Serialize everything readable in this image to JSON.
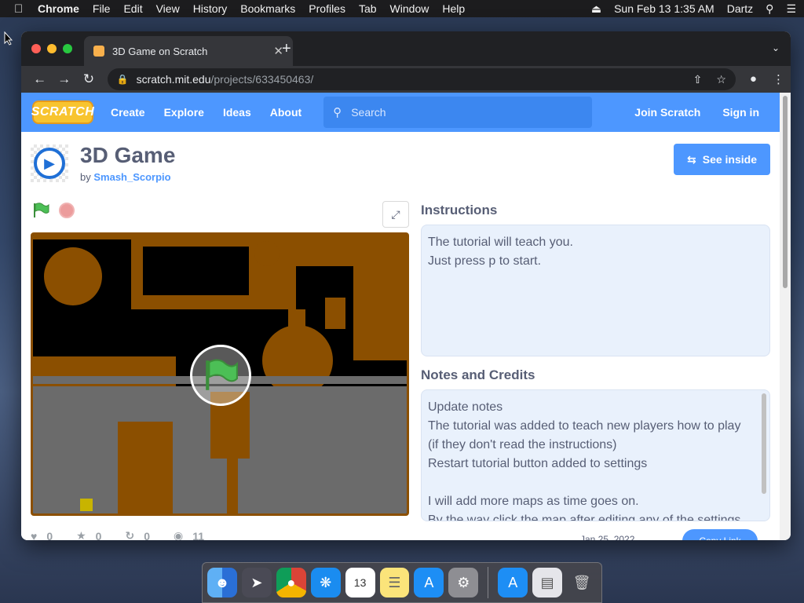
{
  "menubar": {
    "app_name": "Chrome",
    "items": [
      "File",
      "Edit",
      "View",
      "History",
      "Bookmarks",
      "Profiles",
      "Tab",
      "Window",
      "Help"
    ],
    "datetime": "Sun Feb 13  1:35 AM",
    "user": "Dartz"
  },
  "browser": {
    "tab_title": "3D Game on Scratch",
    "url_domain": "scratch.mit.edu",
    "url_path": "/projects/633450463/"
  },
  "scratch_nav": {
    "logo": "SCRATCH",
    "links": [
      "Create",
      "Explore",
      "Ideas",
      "About"
    ],
    "search_placeholder": "Search",
    "join": "Join Scratch",
    "signin": "Sign in"
  },
  "project": {
    "title": "3D Game",
    "by_label": "by",
    "author": "Smash_Scorpio",
    "see_inside": "See inside"
  },
  "instructions": {
    "heading": "Instructions",
    "lines": [
      "The tutorial will teach you.",
      "Just press p to start."
    ]
  },
  "notes": {
    "heading": "Notes and Credits",
    "lines": [
      "Update notes",
      "The tutorial was added to teach new players how to play",
      "(if they don't read the instructions)",
      "Restart tutorial button added to settings",
      "",
      "I will add more maps as time goes on.",
      "By the way click the map after editing any of the settings."
    ]
  },
  "stats": {
    "loves": "0",
    "favorites": "0",
    "remixes": "0",
    "views": "11",
    "date": "Jan 25, 2022",
    "copy_link": "Copy Link"
  },
  "colors": {
    "scratch_blue": "#4d97ff",
    "stage_brown": "#8b4f00",
    "stage_gray": "#6b6b6b"
  }
}
